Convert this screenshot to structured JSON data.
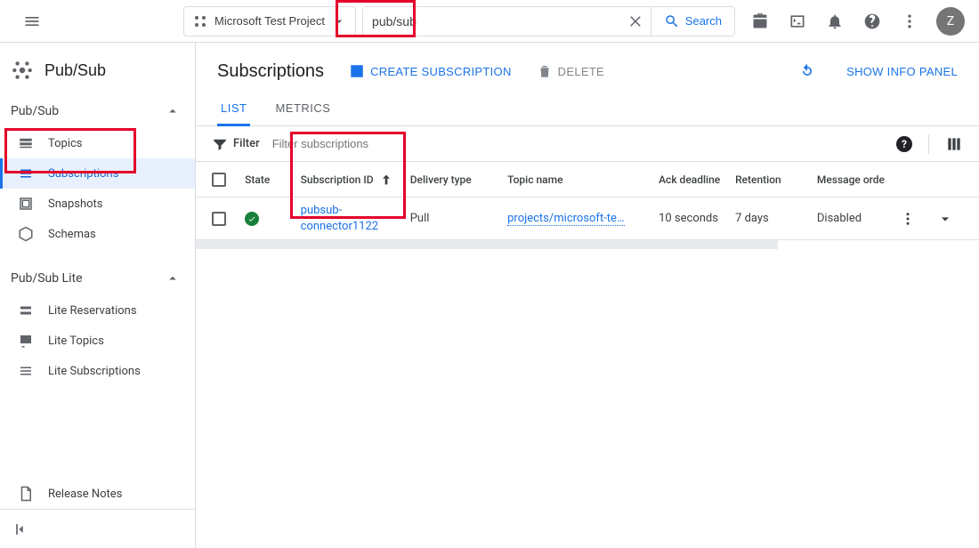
{
  "topbar": {
    "project_label": "Microsoft Test Project",
    "search_value": "pub/sub",
    "search_button": "Search",
    "avatar_initial": "Z"
  },
  "sidebar": {
    "service_title": "Pub/Sub",
    "group1": {
      "title": "Pub/Sub",
      "items": [
        "Topics",
        "Subscriptions",
        "Snapshots",
        "Schemas"
      ]
    },
    "group2": {
      "title": "Pub/Sub Lite",
      "items": [
        "Lite Reservations",
        "Lite Topics",
        "Lite Subscriptions"
      ]
    },
    "release_notes": "Release Notes"
  },
  "header": {
    "title": "Subscriptions",
    "create_btn": "Create Subscription",
    "delete_btn": "Delete",
    "show_info": "SHOW INFO PANEL"
  },
  "tabs": [
    "LIST",
    "METRICS"
  ],
  "filter": {
    "label": "Filter",
    "placeholder": "Filter subscriptions"
  },
  "table": {
    "columns": {
      "state": "State",
      "sub_id": "Subscription ID",
      "delivery": "Delivery type",
      "topic": "Topic name",
      "ack": "Ack deadline",
      "ret": "Retention",
      "order": "Message orde"
    },
    "rows": [
      {
        "sub_id": "pubsub-connector1122",
        "delivery": "Pull",
        "topic": "projects/microsoft-te…",
        "ack": "10 seconds",
        "ret": "7 days",
        "order": "Disabled"
      }
    ]
  }
}
